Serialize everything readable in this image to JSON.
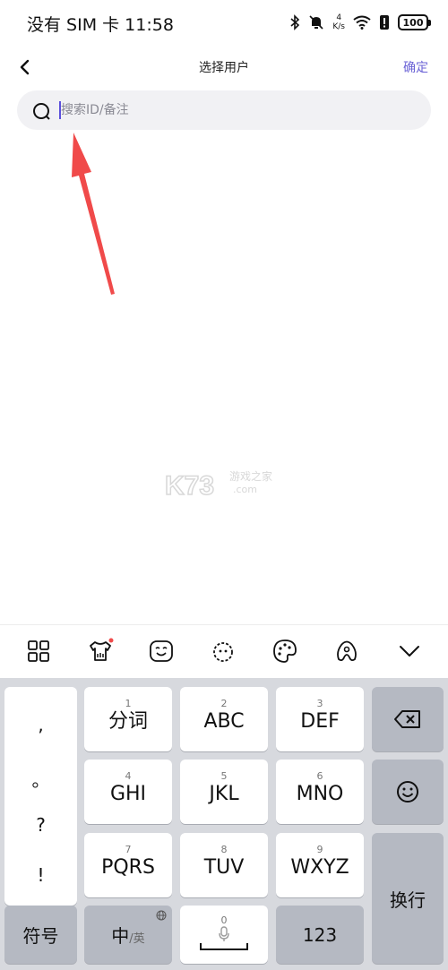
{
  "status_bar": {
    "carrier_time": "没有 SIM 卡 11:58",
    "speed_value": "4",
    "speed_unit": "K/s",
    "battery": "100"
  },
  "nav": {
    "title": "选择用户",
    "confirm": "确定"
  },
  "search": {
    "placeholder": "搜索ID/备注",
    "value": ""
  },
  "watermark": {
    "brand": "K73",
    "cn": "游戏之家",
    "domain": ".com"
  },
  "keyboard": {
    "rows": [
      {
        "num": "1",
        "label": "分词"
      },
      {
        "num": "2",
        "label": "ABC"
      },
      {
        "num": "3",
        "label": "DEF"
      },
      {
        "num": "4",
        "label": "GHI"
      },
      {
        "num": "5",
        "label": "JKL"
      },
      {
        "num": "6",
        "label": "MNO"
      },
      {
        "num": "7",
        "label": "PQRS"
      },
      {
        "num": "8",
        "label": "TUV"
      },
      {
        "num": "9",
        "label": "WXYZ"
      }
    ],
    "symbols": [
      ",",
      "。",
      "?",
      "!"
    ],
    "symbol_key": "符号",
    "lang_key_main": "中",
    "lang_key_alt": "/英",
    "space_num": "0",
    "num_key": "123",
    "enter_key": "换行"
  },
  "colors": {
    "accent": "#6b63d6",
    "arrow": "#f04a4a",
    "keyboard_bg": "#d7d9de",
    "gray_key": "#b5b9c2"
  }
}
